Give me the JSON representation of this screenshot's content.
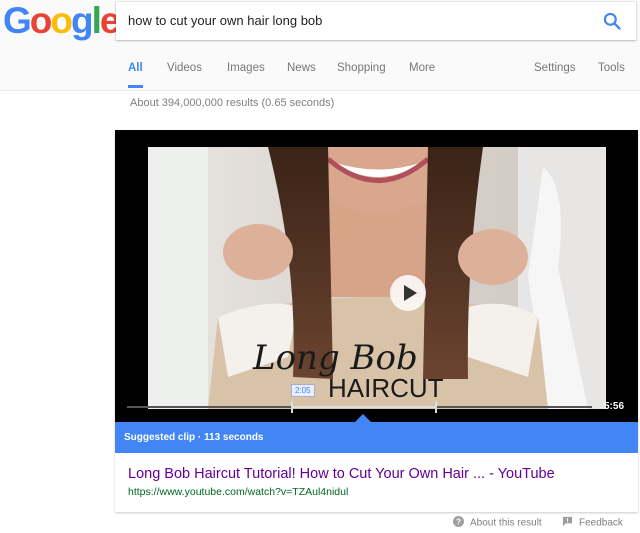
{
  "logo": {
    "letters": [
      "G",
      "o",
      "o",
      "g",
      "l",
      "e"
    ],
    "colors": [
      "#4285f4",
      "#ea4335",
      "#fbbc05",
      "#4285f4",
      "#34a853",
      "#ea4335"
    ]
  },
  "search": {
    "query": "how to cut your own hair long bob",
    "button_icon": "search-icon"
  },
  "tabs": [
    {
      "label": "All",
      "active": true
    },
    {
      "label": "Videos"
    },
    {
      "label": "Images"
    },
    {
      "label": "News"
    },
    {
      "label": "Shopping"
    },
    {
      "label": "More"
    },
    {
      "label": "Settings"
    },
    {
      "label": "Tools"
    }
  ],
  "result_stats": "About 394,000,000 results (0.65 seconds)",
  "video": {
    "thumbnail_title_line1": "Long Bob",
    "thumbnail_title_line2": "HAIRCUT",
    "clip_start": "2:05",
    "duration": "5:56",
    "suggested_clip": "Suggested clip · 113 seconds",
    "play_icon": "play-icon"
  },
  "result": {
    "title": "Long Bob Haircut Tutorial! How to Cut Your Own Hair ... - YouTube",
    "url": "https://www.youtube.com/watch?v=TZAul4nidul"
  },
  "footer": {
    "about": "About this result",
    "feedback": "Feedback"
  },
  "colors": {
    "accent": "#4285f4",
    "visited_link": "#660099",
    "url_green": "#006621"
  }
}
